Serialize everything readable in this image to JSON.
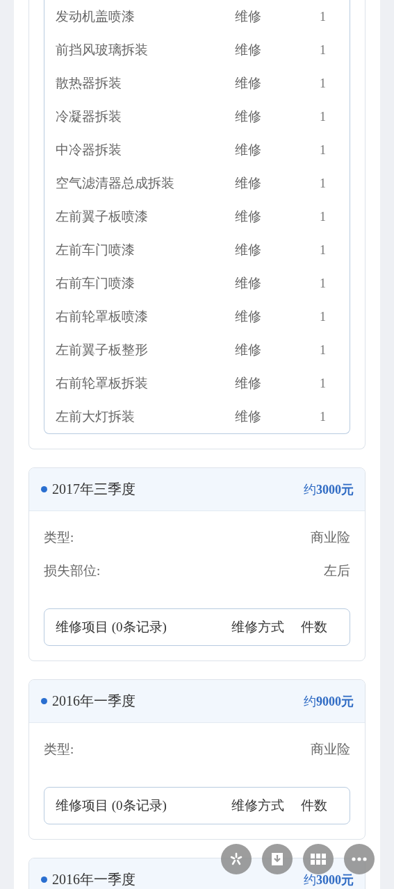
{
  "records": [
    {
      "items": [
        {
          "name": "发动机盖喷漆",
          "method": "维修",
          "count": "1"
        },
        {
          "name": "前挡风玻璃拆装",
          "method": "维修",
          "count": "1"
        },
        {
          "name": "散热器拆装",
          "method": "维修",
          "count": "1"
        },
        {
          "name": "冷凝器拆装",
          "method": "维修",
          "count": "1"
        },
        {
          "name": "中冷器拆装",
          "method": "维修",
          "count": "1"
        },
        {
          "name": "空气滤清器总成拆装",
          "method": "维修",
          "count": "1"
        },
        {
          "name": "左前翼子板喷漆",
          "method": "维修",
          "count": "1"
        },
        {
          "name": "左前车门喷漆",
          "method": "维修",
          "count": "1"
        },
        {
          "name": "右前车门喷漆",
          "method": "维修",
          "count": "1"
        },
        {
          "name": "右前轮罩板喷漆",
          "method": "维修",
          "count": "1"
        },
        {
          "name": "左前翼子板整形",
          "method": "维修",
          "count": "1"
        },
        {
          "name": "右前轮罩板拆装",
          "method": "维修",
          "count": "1"
        },
        {
          "name": "左前大灯拆装",
          "method": "维修",
          "count": "1"
        }
      ]
    },
    {
      "period": "2017年三季度",
      "amount": "约**3000元**",
      "fields": [
        {
          "label": "类型:",
          "value": "商业险"
        },
        {
          "label": "损失部位:",
          "value": "左后"
        }
      ],
      "items_header": {
        "title": "维修项目 (0条记录)",
        "method": "维修方式",
        "count": "件数"
      }
    },
    {
      "period": "2016年一季度",
      "amount": "约**9000元**",
      "fields": [
        {
          "label": "类型:",
          "value": "商业险"
        }
      ],
      "items_header": {
        "title": "维修项目 (0条记录)",
        "method": "维修方式",
        "count": "件数"
      }
    },
    {
      "period": "2016年一季度",
      "amount": "约**3000元**"
    }
  ]
}
